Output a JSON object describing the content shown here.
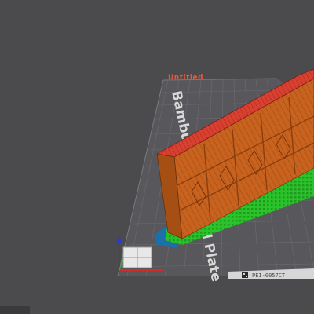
{
  "viewport": {
    "plate_name": "Untitled",
    "plate_watermark": "Bambu Textured PEI Plate",
    "plate_id": "PEI-0057CT",
    "colors": {
      "background": "#4b4b4e",
      "plate": "#5a5a5e",
      "grid_line": "#6a6a6e",
      "plate_title": "#e05a3c",
      "model_body": "#c8621f",
      "model_top": "#d94030",
      "support": "#27c027",
      "brim": "#1c6fa8",
      "axis_x": "#d22b2b",
      "axis_y": "#2bb52b",
      "axis_z": "#2b3bd2"
    },
    "icons": [
      "axis-gizmo-icon",
      "qr-code-icon"
    ]
  }
}
